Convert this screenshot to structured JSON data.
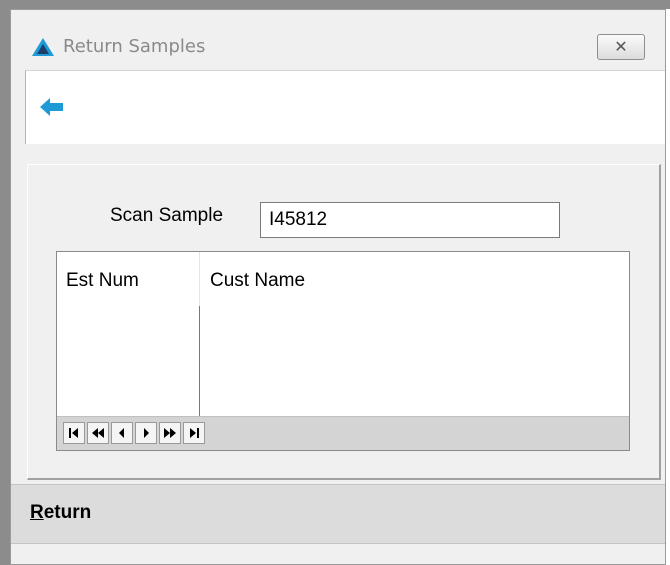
{
  "window": {
    "title": "Return Samples",
    "close_symbol": "✕"
  },
  "toolbar": {
    "back_icon": "arrow-left-icon",
    "accent_color": "#1e9bd7"
  },
  "scan": {
    "label": "Scan Sample",
    "value": "I45812"
  },
  "grid": {
    "columns": [
      "Est Num",
      "Cust Name"
    ],
    "rows": [],
    "navigation": [
      "first-record-icon",
      "previous-page-icon",
      "previous-record-icon",
      "next-record-icon",
      "next-page-icon",
      "last-record-icon"
    ]
  },
  "footer": {
    "return_underlined": "R",
    "return_rest": "eturn"
  }
}
